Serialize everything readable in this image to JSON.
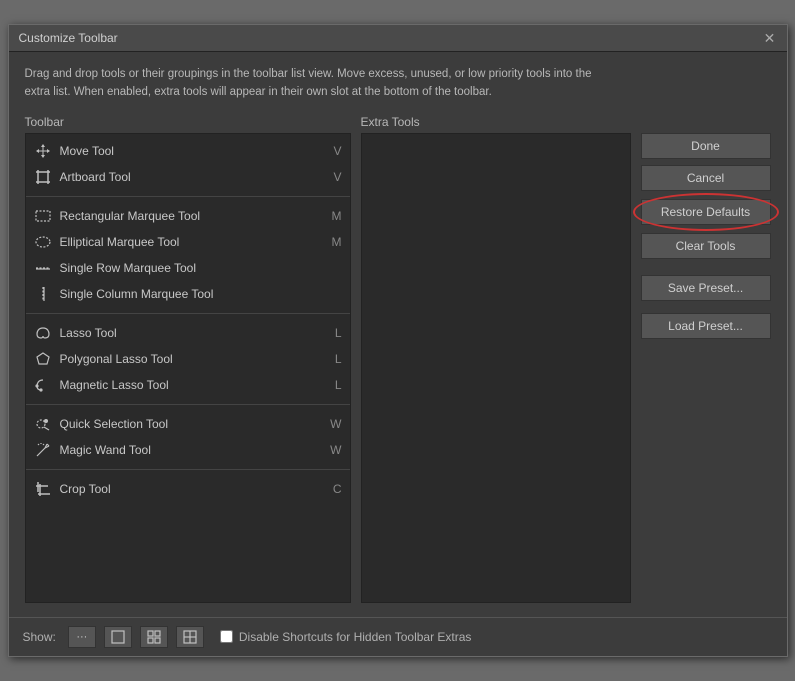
{
  "dialog": {
    "title": "Customize Toolbar",
    "close_label": "✕",
    "description": "Drag and drop tools or their groupings in the toolbar list view. Move excess, unused, or low priority tools into\nthe extra list. When enabled, extra tools will appear in their own slot at the bottom of the toolbar."
  },
  "toolbar_section": {
    "label": "Toolbar"
  },
  "extra_tools_section": {
    "label": "Extra Tools"
  },
  "tool_groups": [
    {
      "tools": [
        {
          "name": "Move Tool",
          "shortcut": "V",
          "icon": "move"
        },
        {
          "name": "Artboard Tool",
          "shortcut": "V",
          "icon": "artboard"
        }
      ]
    },
    {
      "tools": [
        {
          "name": "Rectangular Marquee Tool",
          "shortcut": "M",
          "icon": "rect-marquee"
        },
        {
          "name": "Elliptical Marquee Tool",
          "shortcut": "M",
          "icon": "ellipse-marquee"
        },
        {
          "name": "Single Row Marquee Tool",
          "shortcut": "",
          "icon": "single-row"
        },
        {
          "name": "Single Column Marquee Tool",
          "shortcut": "",
          "icon": "single-col"
        }
      ]
    },
    {
      "tools": [
        {
          "name": "Lasso Tool",
          "shortcut": "L",
          "icon": "lasso"
        },
        {
          "name": "Polygonal Lasso Tool",
          "shortcut": "L",
          "icon": "poly-lasso"
        },
        {
          "name": "Magnetic Lasso Tool",
          "shortcut": "L",
          "icon": "mag-lasso"
        }
      ]
    },
    {
      "tools": [
        {
          "name": "Quick Selection Tool",
          "shortcut": "W",
          "icon": "quick-sel"
        },
        {
          "name": "Magic Wand Tool",
          "shortcut": "W",
          "icon": "magic-wand"
        }
      ]
    },
    {
      "tools": [
        {
          "name": "Crop Tool",
          "shortcut": "C",
          "icon": "crop"
        }
      ]
    }
  ],
  "buttons": {
    "done": "Done",
    "cancel": "Cancel",
    "restore_defaults": "Restore Defaults",
    "clear_tools": "Clear Tools",
    "save_preset": "Save Preset...",
    "load_preset": "Load Preset..."
  },
  "bottom": {
    "show_label": "Show:",
    "btn1": "···",
    "btn2": "⬜",
    "btn3": "⊞",
    "btn4": "⊡",
    "checkbox_label": "Disable Shortcuts for Hidden Toolbar Extras",
    "checkbox_checked": false
  }
}
